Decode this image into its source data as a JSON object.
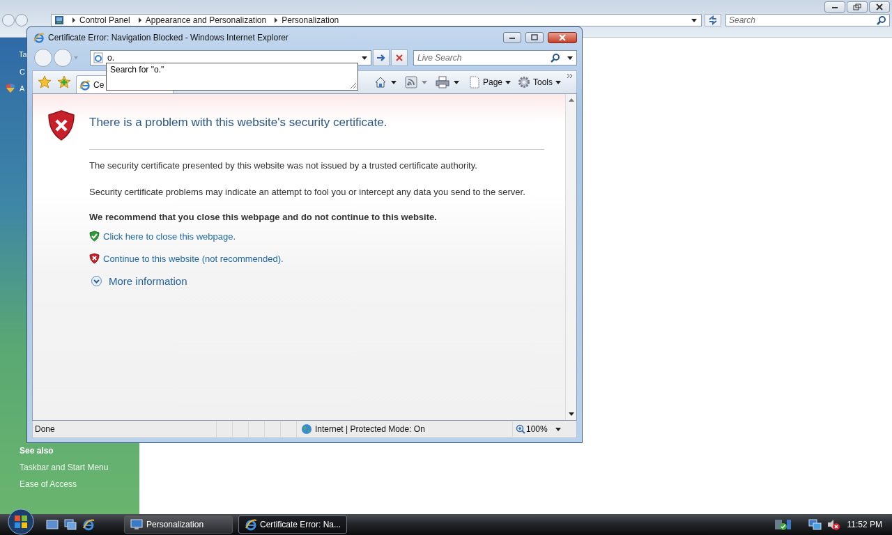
{
  "background_window": {
    "breadcrumb": [
      "Control Panel",
      "Appearance and Personalization",
      "Personalization"
    ],
    "search": {
      "placeholder": "Search"
    },
    "sidebar": {
      "cut_links": [
        "Ta",
        "C",
        "A"
      ],
      "see_also": {
        "heading": "See also",
        "links": [
          "Taskbar and Start Menu",
          "Ease of Access"
        ]
      }
    }
  },
  "ie_window": {
    "title": "Certificate Error: Navigation Blocked - Windows Internet Explorer",
    "address": {
      "value": "o."
    },
    "search": {
      "placeholder": "Live Search"
    },
    "suggestion": "Search for \"o.\"",
    "tab": {
      "label": "Ce",
      "selected": true
    },
    "toolbar": [
      "Page",
      "Tools"
    ],
    "content": {
      "heading": "There is a problem with this website's security certificate.",
      "paragraphs": [
        "The security certificate presented by this website was not issued by a trusted certificate authority.",
        "Security certificate problems may indicate an attempt to fool you or intercept any data you send to the server."
      ],
      "recommendation": "We recommend that you close this webpage and do not continue to this website.",
      "links": [
        {
          "kind": "safe",
          "text": "Click here to close this webpage."
        },
        {
          "kind": "unsafe",
          "text": "Continue to this website (not recommended)."
        }
      ],
      "more_info": "More information"
    },
    "status": {
      "text": "Done",
      "zone": "Internet | Protected Mode: On",
      "zoom": "100%"
    }
  },
  "taskbar": {
    "tasks": [
      {
        "label": "Personalization",
        "selected": false
      },
      {
        "label": "Certificate Error: Na...",
        "selected": true
      }
    ],
    "clock": "11:52 PM"
  }
}
